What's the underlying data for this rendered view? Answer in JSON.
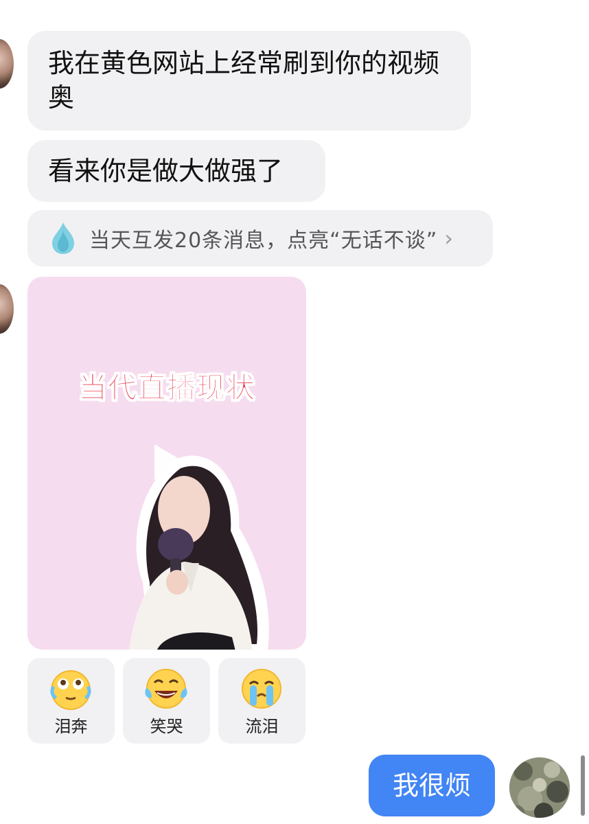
{
  "messages": {
    "incoming_1": "我在黄色网站上经常刷到你的视频奥",
    "incoming_2": "看来你是做大做强了",
    "streak_banner": "当天互发20条消息，点亮“无话不谈”",
    "video": {
      "title": "当代直播现状"
    },
    "reactions": [
      {
        "label": "泪奔",
        "icon": "tears-of-joy-face-icon"
      },
      {
        "label": "笑哭",
        "icon": "laughing-crying-face-icon"
      },
      {
        "label": "流泪",
        "icon": "crying-face-icon"
      }
    ],
    "outgoing_1": "我很烦"
  },
  "icons": {
    "banner": "flame-icon",
    "banner_arrow": "chevron-right-icon",
    "video_play": "play-icon"
  },
  "colors": {
    "incoming_bubble": "#f1f1f3",
    "outgoing_bubble": "#4285f4",
    "flame": "#7fd0e2",
    "video_bg": "#f6dcef",
    "video_title": "#e8344a"
  }
}
